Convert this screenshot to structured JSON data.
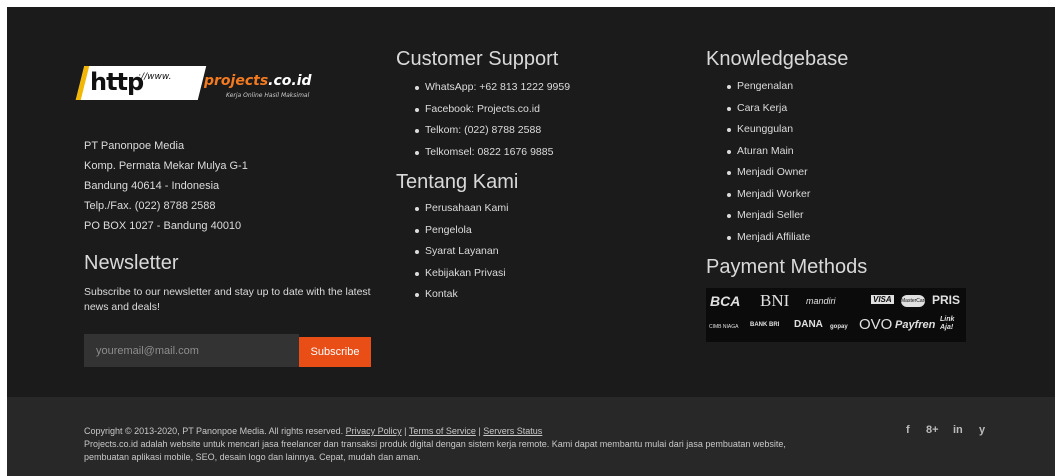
{
  "logo": {
    "http": "http",
    "www": "://www.",
    "brand": "projects",
    "tld": ".co.id",
    "tagline": "Kerja Online Hasil Maksimal"
  },
  "address": {
    "company": "PT Panonpoe Media",
    "street": "Komp. Permata Mekar Mulya G-1",
    "city": "Bandung 40614 - Indonesia",
    "phone": "Telp./Fax. (022) 8788 2588",
    "pobox": "PO BOX 1027 - Bandung 40010"
  },
  "newsletter": {
    "heading": "Newsletter",
    "description": "Subscribe to our newsletter and stay up to date with the latest news and deals!",
    "placeholder": "youremail@mail.com",
    "button": "Subscribe"
  },
  "support": {
    "heading": "Customer Support",
    "items": [
      "WhatsApp: +62 813 1222 9959",
      "Facebook: Projects.co.id",
      "Telkom: (022) 8788 2588",
      "Telkomsel: 0822 1676 9885"
    ]
  },
  "about": {
    "heading": "Tentang Kami",
    "items": [
      "Perusahaan Kami",
      "Pengelola",
      "Syarat Layanan",
      "Kebijakan Privasi",
      "Kontak"
    ]
  },
  "knowledge": {
    "heading": "Knowledgebase",
    "items": [
      "Pengenalan",
      "Cara Kerja",
      "Keunggulan",
      "Aturan Main",
      "Menjadi Owner",
      "Menjadi Worker",
      "Menjadi Seller",
      "Menjadi Affiliate"
    ]
  },
  "payment": {
    "heading": "Payment Methods",
    "logos": [
      "BCA",
      "BNI",
      "mandiri",
      "VISA",
      "MasterCard",
      "PRIS",
      "CIMB NIAGA",
      "BANK BRI",
      "DANA",
      "gopay",
      "OVO",
      "Payfren",
      "Link Aja!"
    ]
  },
  "bottom": {
    "copyright": "Copyright © 2013-2020, PT Panonpoe Media. All rights reserved.",
    "privacy": "Privacy Policy",
    "sep": "|",
    "terms": "Terms of Service",
    "servers": "Servers Status",
    "desc": "Projects.co.id adalah website untuk mencari jasa freelancer dan transaksi produk digital dengan sistem kerja remote. Kami dapat membantu mulai dari jasa pembuatan website, pembuatan aplikasi mobile, SEO, desain logo dan lainnya. Cepat, mudah dan aman."
  },
  "social": {
    "facebook": "f",
    "googleplus": "8+",
    "linkedin": "in",
    "twitter": "y"
  }
}
